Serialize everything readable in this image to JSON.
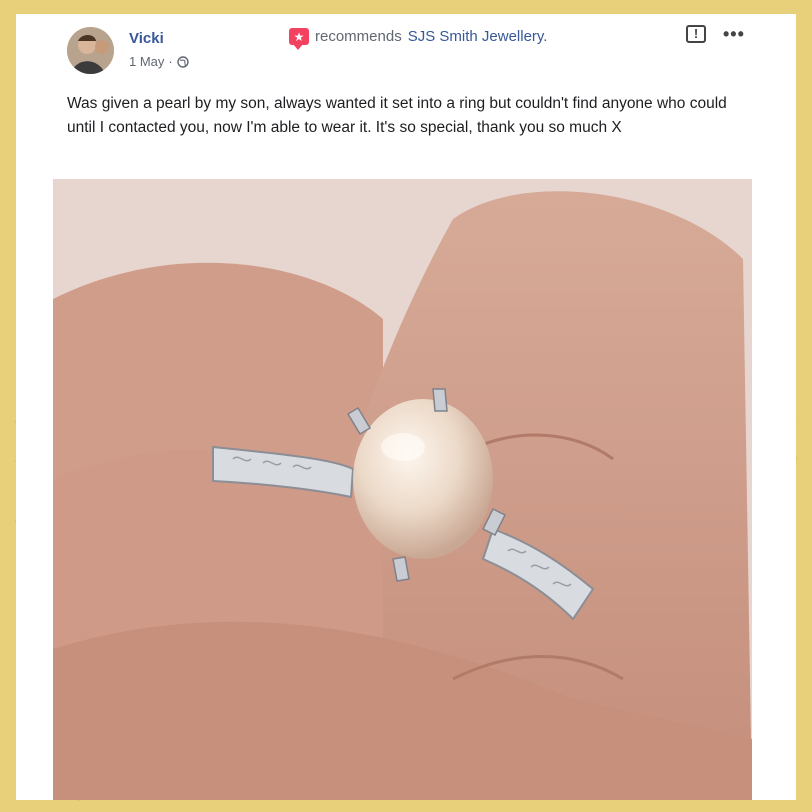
{
  "post": {
    "author": "Vicki",
    "timestamp": "1 May",
    "separator": "·",
    "recommends_text": "recommends",
    "page_name": "SJS Smith Jewellery.",
    "body": "Was given a pearl by my son, always wanted it set into a ring but couldn't find anyone who could until I contacted you, now I'm able to wear it. It's so special, thank you so much X",
    "report_icon": "!",
    "more_icon": "•••"
  },
  "colors": {
    "frame": "#e8cf7a",
    "link": "#365899",
    "recommend_icon": "#f3425f",
    "text": "#1c1e21",
    "meta": "#606770"
  },
  "icons": {
    "recommend": "recommend-star-icon",
    "privacy": "globe-icon",
    "report": "report-icon",
    "more": "more-options-icon"
  }
}
